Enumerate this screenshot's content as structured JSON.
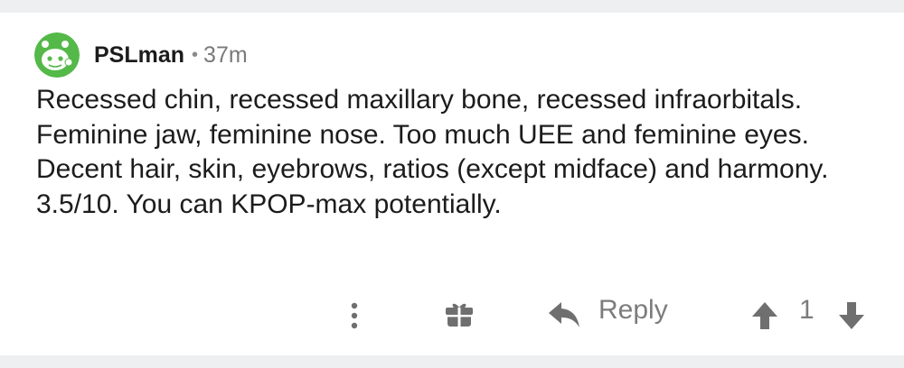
{
  "comment": {
    "username": "PSLman",
    "separator": "•",
    "age": "37m",
    "text": "Recessed chin, recessed maxillary bone, recessed infraorbitals. Feminine jaw, feminine nose. Too much UEE and feminine eyes. Decent hair, skin, eyebrows, ratios (except midface) and harmony. 3.5/10. You can KPOP-max potentially."
  },
  "actions": {
    "reply_label": "Reply",
    "vote_count": "1",
    "icons": {
      "more": "vertical-ellipsis-icon",
      "award": "gift-icon",
      "reply": "reply-arrow-icon",
      "upvote": "upvote-arrow-icon",
      "downvote": "downvote-arrow-icon"
    }
  },
  "colors": {
    "avatar_green": "#54b948",
    "text": "#1c1c1c",
    "muted": "#7c7c7c",
    "icon": "#6f6f6f",
    "background": "#eeeff1"
  }
}
